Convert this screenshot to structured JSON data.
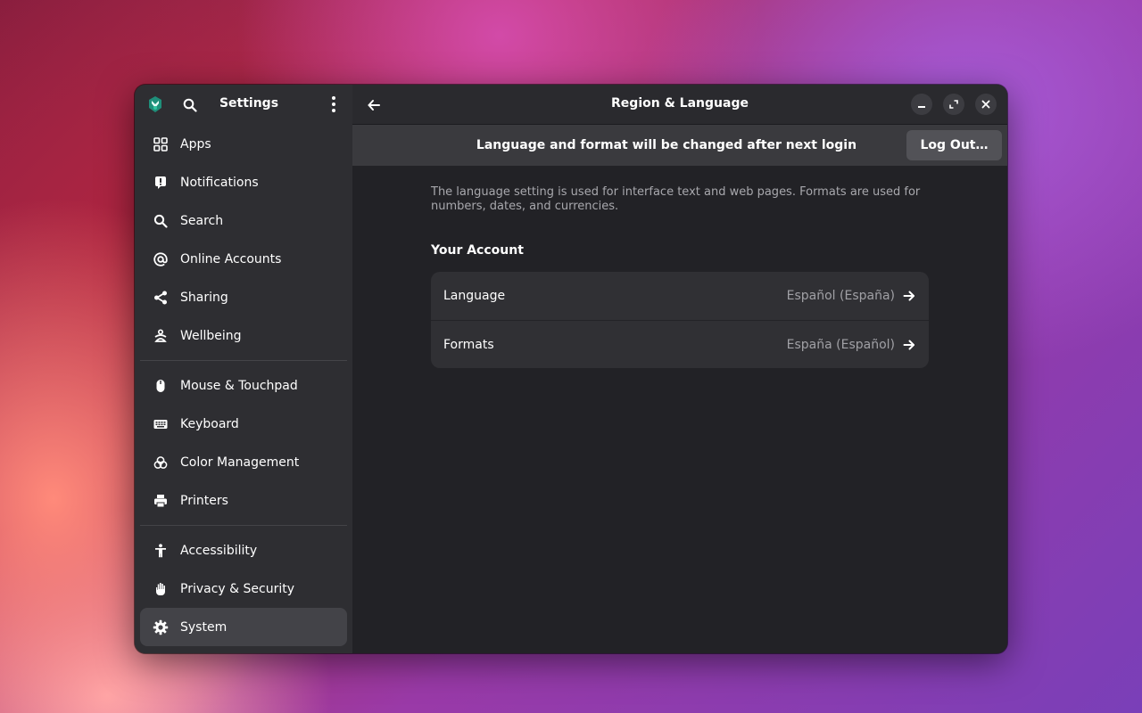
{
  "sidebar": {
    "title": "Settings",
    "app_icon": "settings-app-icon",
    "groups": [
      [
        {
          "label": "Apps",
          "icon": "apps-grid-icon"
        },
        {
          "label": "Notifications",
          "icon": "bell-icon"
        },
        {
          "label": "Search",
          "icon": "search-icon"
        },
        {
          "label": "Online Accounts",
          "icon": "at-icon"
        },
        {
          "label": "Sharing",
          "icon": "share-icon"
        },
        {
          "label": "Wellbeing",
          "icon": "wellbeing-icon"
        }
      ],
      [
        {
          "label": "Mouse & Touchpad",
          "icon": "mouse-icon"
        },
        {
          "label": "Keyboard",
          "icon": "keyboard-icon"
        },
        {
          "label": "Color Management",
          "icon": "color-icon"
        },
        {
          "label": "Printers",
          "icon": "printer-icon"
        }
      ],
      [
        {
          "label": "Accessibility",
          "icon": "accessibility-icon"
        },
        {
          "label": "Privacy & Security",
          "icon": "hand-icon"
        },
        {
          "label": "System",
          "icon": "gear-icon",
          "active": true
        }
      ]
    ]
  },
  "main": {
    "title": "Region & Language",
    "infobar": {
      "message": "Language and format will be changed after next login",
      "button": "Log Out…"
    },
    "description": "The language setting is used for interface text and web pages. Formats are used for numbers, dates, and currencies.",
    "section_title": "Your Account",
    "rows": [
      {
        "label": "Language",
        "value": "Español (España)"
      },
      {
        "label": "Formats",
        "value": "España (Español)"
      }
    ]
  },
  "colors": {
    "sidebar_bg": "#2e2e32",
    "main_bg": "#222226",
    "active_item": "#434348",
    "infobar_bg": "#3a3a3e",
    "app_icon_accent": "#2ec4a0"
  }
}
